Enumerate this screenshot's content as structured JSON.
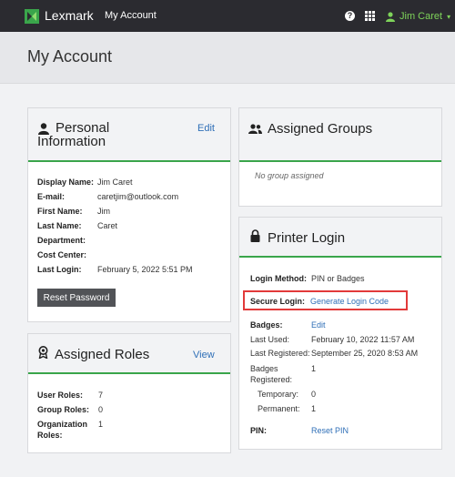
{
  "topbar": {
    "brand": "Lexmark",
    "app_name": "My Account",
    "help_glyph": "?",
    "user_name": "Jim Caret",
    "user_caret": "▾",
    "icons": [
      "lexmark-logo-icon",
      "help-icon",
      "apps-grid-icon",
      "user-icon"
    ]
  },
  "page": {
    "title": "My Account"
  },
  "personal": {
    "title_line1": "Personal",
    "title_line2": "Information",
    "edit_label": "Edit",
    "fields": [
      {
        "label": "Display Name:",
        "value": "Jim Caret"
      },
      {
        "label": "E-mail:",
        "value": "caretjim@outlook.com"
      },
      {
        "label": "First Name:",
        "value": "Jim"
      },
      {
        "label": "Last Name:",
        "value": "Caret"
      },
      {
        "label": "Department:",
        "value": ""
      },
      {
        "label": "Cost Center:",
        "value": ""
      },
      {
        "label": "Last Login:",
        "value": "February 5, 2022 5:51 PM"
      }
    ],
    "reset_password_label": "Reset Password"
  },
  "roles": {
    "title": "Assigned Roles",
    "view_label": "View",
    "fields": [
      {
        "label": "User Roles:",
        "value": "7"
      },
      {
        "label": "Group Roles:",
        "value": "0"
      },
      {
        "label_line1": "Organization",
        "label_line2": "Roles:",
        "value": "1"
      }
    ]
  },
  "groups": {
    "title": "Assigned Groups",
    "empty_message": "No group assigned"
  },
  "printer_login": {
    "title": "Printer Login",
    "login_method_label": "Login Method:",
    "login_method_value": "PIN or Badges",
    "secure_login_label": "Secure Login:",
    "secure_login_link": "Generate Login Code",
    "badges_label": "Badges:",
    "badges_edit": "Edit",
    "last_used_label": "Last Used:",
    "last_used_value": "February 10, 2022 11:57 AM",
    "last_registered_label": "Last Registered:",
    "last_registered_value": "September 25, 2020 8:53 AM",
    "badges_registered_line1": "Badges",
    "badges_registered_line2": "Registered:",
    "badges_registered_value": "1",
    "temporary_label": "Temporary:",
    "temporary_value": "0",
    "permanent_label": "Permanent:",
    "permanent_value": "1",
    "pin_label": "PIN:",
    "pin_link": "Reset PIN"
  },
  "colors": {
    "topbar_bg": "#2b2b30",
    "accent_green": "#3aa54b",
    "user_green": "#7ed35a",
    "link_blue": "#2f6fb7",
    "highlight_red": "#e23a3a"
  }
}
